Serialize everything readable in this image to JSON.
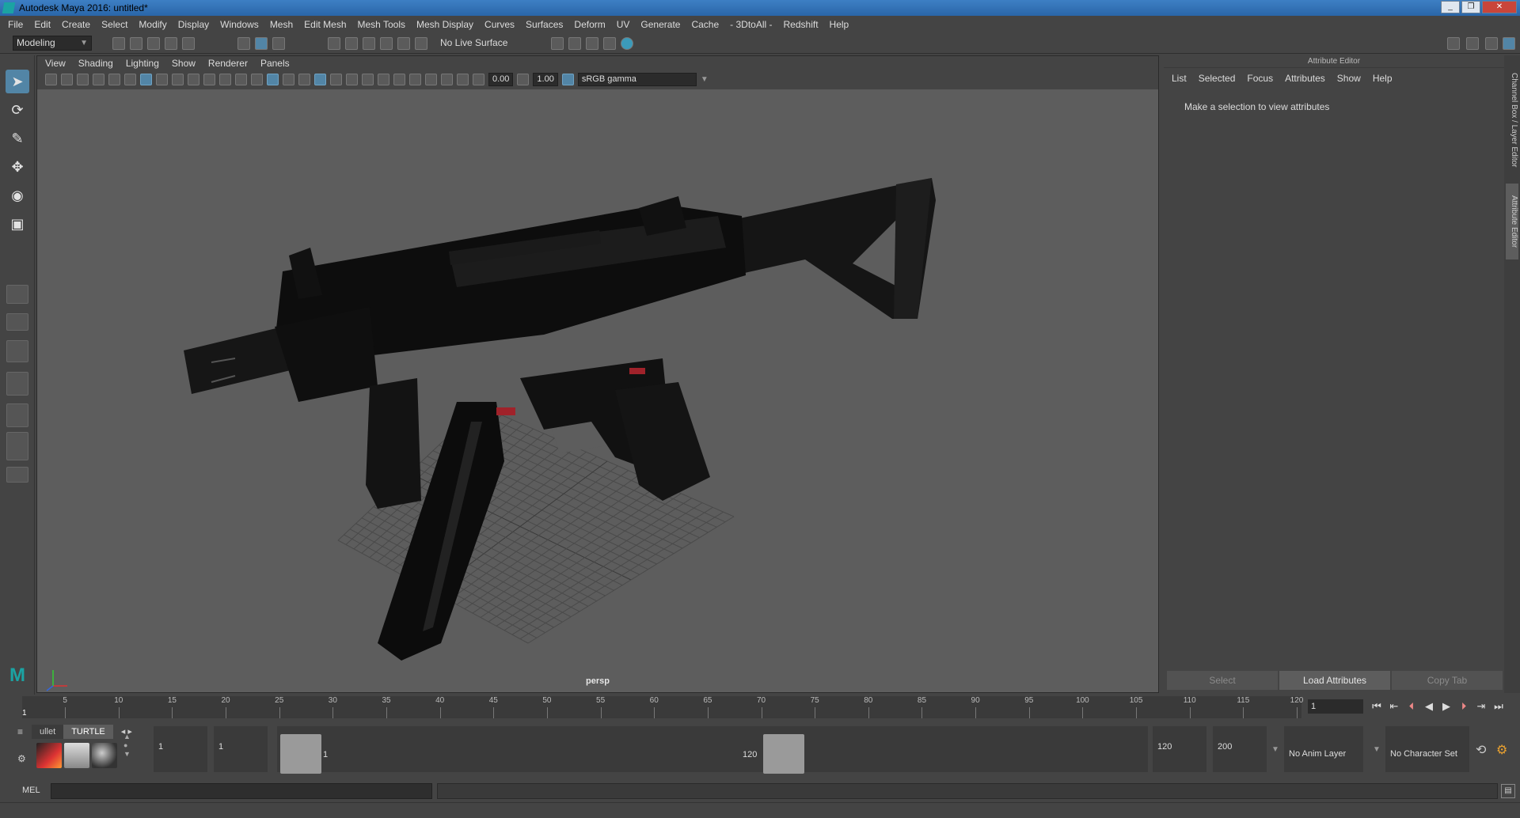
{
  "window": {
    "title": "Autodesk Maya 2016: untitled*"
  },
  "menubar": [
    "File",
    "Edit",
    "Create",
    "Select",
    "Modify",
    "Display",
    "Windows",
    "Mesh",
    "Edit Mesh",
    "Mesh Tools",
    "Mesh Display",
    "Curves",
    "Surfaces",
    "Deform",
    "UV",
    "Generate",
    "Cache",
    "- 3DtoAll -",
    "Redshift",
    "Help"
  ],
  "statusline": {
    "mode": "Modeling",
    "live_surface": "No Live Surface"
  },
  "viewport": {
    "menu": [
      "View",
      "Shading",
      "Lighting",
      "Show",
      "Renderer",
      "Panels"
    ],
    "exposure": "0.00",
    "gamma": "1.00",
    "color_space": "sRGB gamma",
    "camera": "persp"
  },
  "attribute_editor": {
    "title": "Attribute Editor",
    "menu": [
      "List",
      "Selected",
      "Focus",
      "Attributes",
      "Show",
      "Help"
    ],
    "message": "Make a selection to view attributes",
    "buttons": {
      "select": "Select",
      "load": "Load Attributes",
      "copy_tab": "Copy Tab"
    },
    "side_tabs": {
      "channel_box": "Channel Box / Layer Editor",
      "attribute_editor": "Attribute Editor"
    }
  },
  "timeline": {
    "ticks": [
      "5",
      "10",
      "15",
      "20",
      "25",
      "30",
      "35",
      "40",
      "45",
      "50",
      "55",
      "60",
      "65",
      "70",
      "75",
      "80",
      "85",
      "90",
      "95",
      "100",
      "105",
      "110",
      "115",
      "120"
    ],
    "current_frame_label": "1",
    "current_frame": "1"
  },
  "shelf": {
    "tabs": [
      "ullet",
      "TURTLE"
    ]
  },
  "range": {
    "start": "1",
    "playback_start": "1",
    "handle_start": "1",
    "handle_end": "120",
    "playback_end": "120",
    "end": "200",
    "anim_layer": "No Anim Layer",
    "character_set": "No Character Set"
  },
  "command_line": {
    "label": "MEL"
  },
  "colors": {
    "accent": "#5285a6",
    "maya_teal": "#1ba3a3",
    "viewport_bg": "#5d5d5d"
  }
}
